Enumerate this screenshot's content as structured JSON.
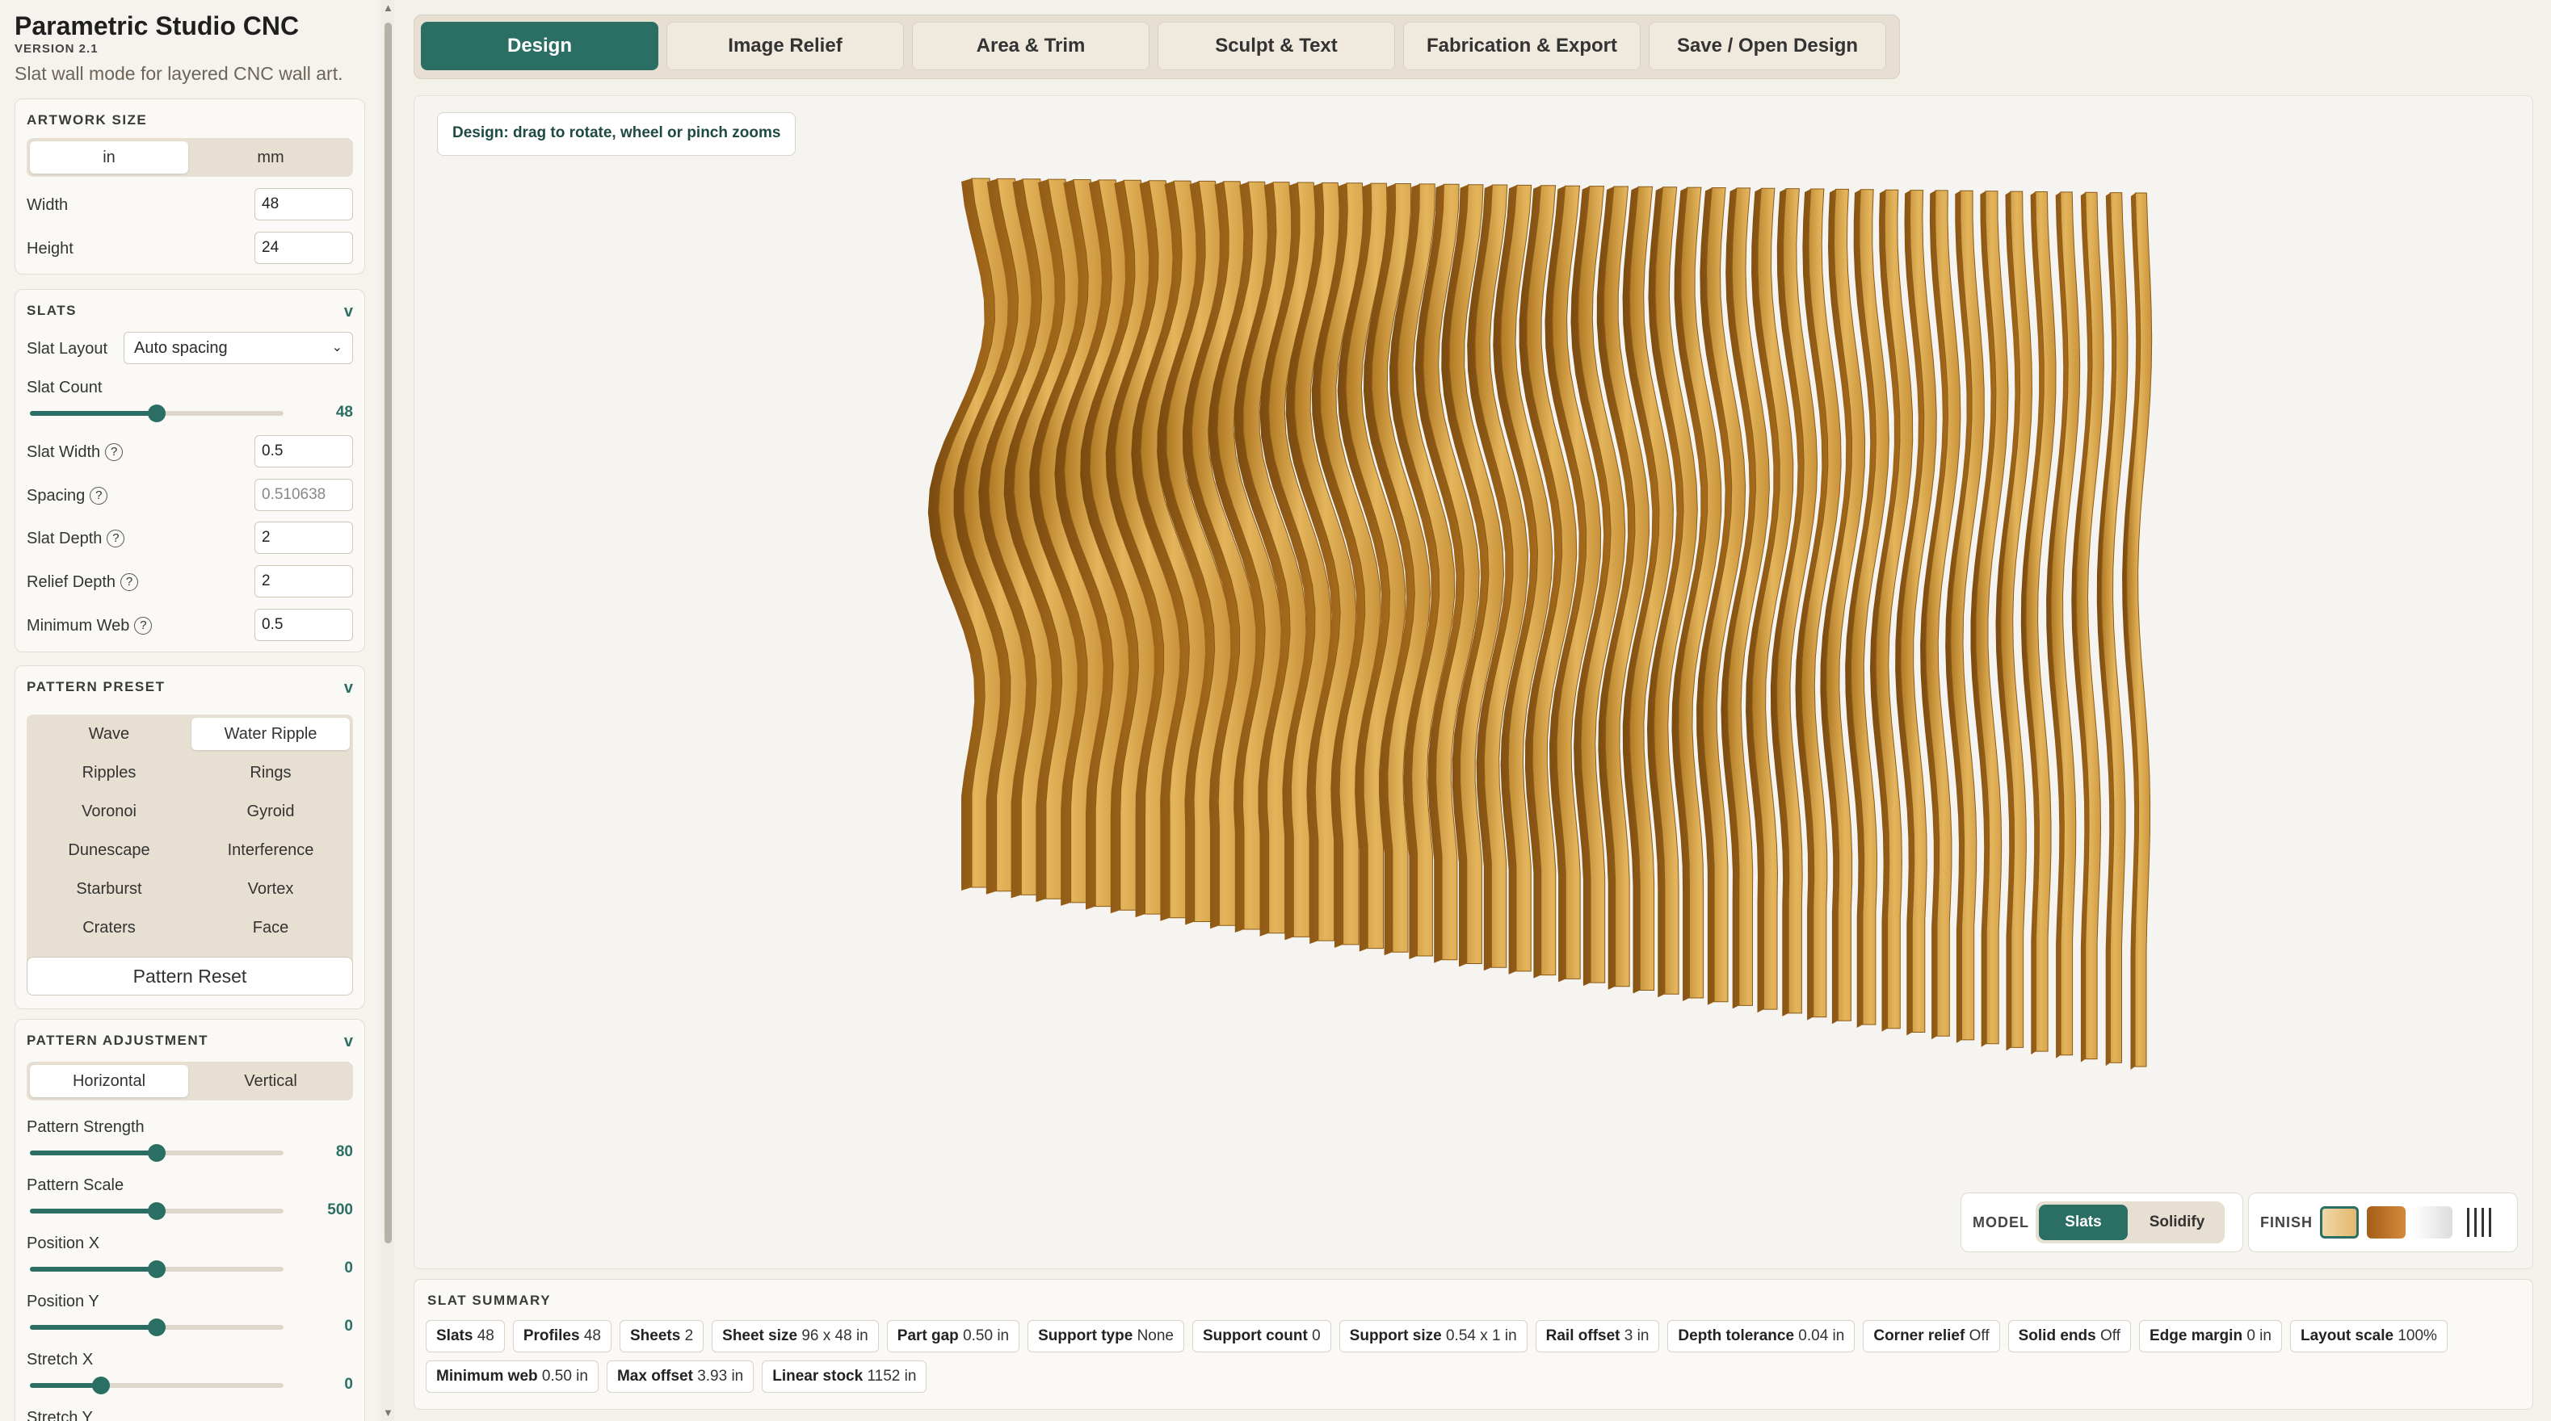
{
  "app": {
    "title": "Parametric Studio CNC",
    "version": "VERSION 2.1",
    "subtitle": "Slat wall mode for layered CNC wall art."
  },
  "artwork": {
    "title": "ARTWORK SIZE",
    "units": [
      "in",
      "mm"
    ],
    "active_unit": "in",
    "width_label": "Width",
    "width": "48",
    "height_label": "Height",
    "height": "24"
  },
  "slats": {
    "title": "SLATS",
    "chevron": "v",
    "layout_label": "Slat Layout",
    "layout_value": "Auto spacing",
    "count_label": "Slat Count",
    "count_value": "48",
    "count_fraction": 0.5,
    "width_label": "Slat Width",
    "width_value": "0.5",
    "spacing_label": "Spacing",
    "spacing_value": "0.510638",
    "depth_label": "Slat Depth",
    "depth_value": "2",
    "relief_label": "Relief Depth",
    "relief_value": "2",
    "web_label": "Minimum Web",
    "web_value": "0.5",
    "help": "?"
  },
  "preset": {
    "title": "PATTERN PRESET",
    "chevron": "v",
    "items": [
      "Wave",
      "Water Ripple",
      "Ripples",
      "Rings",
      "Voronoi",
      "Gyroid",
      "Dunescape",
      "Interference",
      "Starburst",
      "Vortex",
      "Craters",
      "Face"
    ],
    "active": "Water Ripple",
    "reset_label": "Pattern Reset"
  },
  "adjust": {
    "title": "PATTERN ADJUSTMENT",
    "chevron": "v",
    "orientations": [
      "Horizontal",
      "Vertical"
    ],
    "active_orientation": "Horizontal",
    "strength_label": "Pattern Strength",
    "strength_value": "80",
    "strength_fraction": 0.5,
    "scale_label": "Pattern Scale",
    "scale_value": "500",
    "scale_fraction": 0.5,
    "posx_label": "Position X",
    "posx_value": "0",
    "posx_fraction": 0.5,
    "posy_label": "Position Y",
    "posy_value": "0",
    "posy_fraction": 0.5,
    "stretchx_label": "Stretch X",
    "stretchx_value": "0",
    "stretchx_fraction": 0.28,
    "stretchy_label": "Stretch Y"
  },
  "tabs": [
    "Design",
    "Image Relief",
    "Area & Trim",
    "Sculpt & Text",
    "Fabrication & Export",
    "Save / Open Design"
  ],
  "active_tab": "Design",
  "viewport": {
    "hint": "Design: drag to rotate, wheel or pinch zooms",
    "model_label": "MODEL",
    "model_options": [
      "Slats",
      "Solidify"
    ],
    "active_model": "Slats",
    "finish_label": "FINISH",
    "finishes": [
      "light-wood",
      "dark-wood",
      "white",
      "slat-lines"
    ],
    "wood_light": "#e2b35a",
    "wood_dark": "#8a5a17",
    "accent": "#2b6e64"
  },
  "summary": {
    "title": "SLAT SUMMARY",
    "chips": [
      {
        "k": "Slats",
        "v": "48"
      },
      {
        "k": "Profiles",
        "v": "48"
      },
      {
        "k": "Sheets",
        "v": "2"
      },
      {
        "k": "Sheet size",
        "v": "96 x 48 in"
      },
      {
        "k": "Part gap",
        "v": "0.50 in"
      },
      {
        "k": "Support type",
        "v": "None"
      },
      {
        "k": "Support count",
        "v": "0"
      },
      {
        "k": "Support size",
        "v": "0.54 x 1 in"
      },
      {
        "k": "Rail offset",
        "v": "3 in"
      },
      {
        "k": "Depth tolerance",
        "v": "0.04 in"
      },
      {
        "k": "Corner relief",
        "v": "Off"
      },
      {
        "k": "Solid ends",
        "v": "Off"
      },
      {
        "k": "Edge margin",
        "v": "0 in"
      },
      {
        "k": "Layout scale",
        "v": "100%"
      },
      {
        "k": "Minimum web",
        "v": "0.50 in"
      },
      {
        "k": "Max offset",
        "v": "3.93 in"
      },
      {
        "k": "Linear stock",
        "v": "1152 in"
      }
    ]
  }
}
